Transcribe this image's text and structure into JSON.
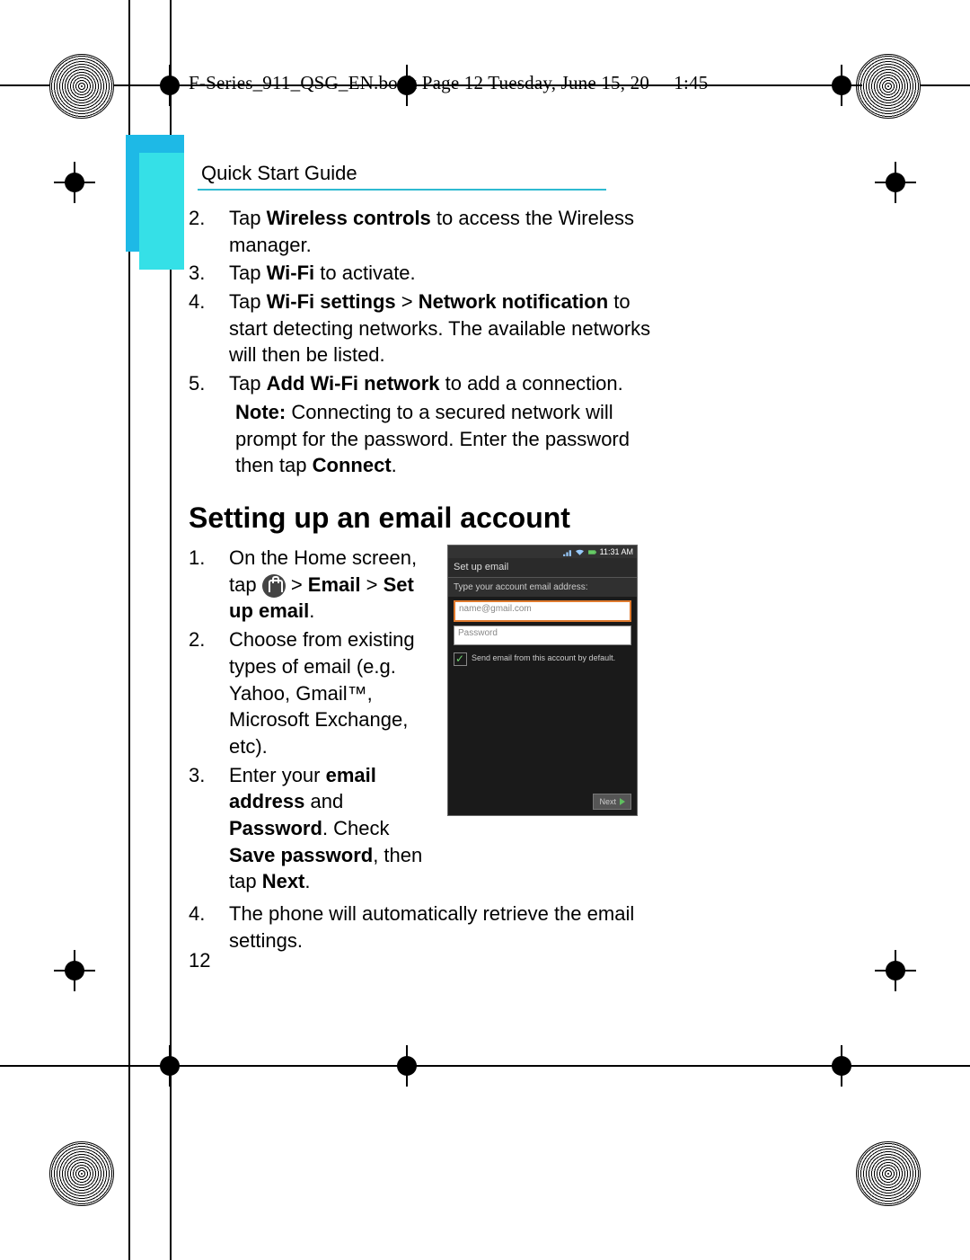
{
  "file_header": "F-Series_911_QSG_EN.book  Page 12  Tuesday, June 15, 20",
  "file_header_time_fragment": "1:45",
  "section_title": "Quick Start Guide",
  "wifi_steps": [
    {
      "n": "2.",
      "pre": "Tap ",
      "b1": "Wireless controls",
      "post": " to access the Wireless manager."
    },
    {
      "n": "3.",
      "pre": "Tap ",
      "b1": "Wi-Fi",
      "post": " to activate."
    },
    {
      "n": "4.",
      "pre": "Tap ",
      "b1": "Wi-Fi settings",
      "mid": " > ",
      "b2": "Network notification",
      "post": " to start detecting networks. The available networks will then be listed."
    },
    {
      "n": "5.",
      "pre": "Tap ",
      "b1": "Add Wi-Fi network",
      "post": " to add a connection."
    }
  ],
  "note_label": "Note:",
  "note_text": " Connecting to a secured network will prompt for the password. Enter the password then tap ",
  "note_bold_tail": "Connect",
  "note_period": ".",
  "heading_email": "Setting up an email account",
  "email_steps": {
    "s1_a": "On the Home screen, tap ",
    "s1_b": " > ",
    "s1_c": "Email",
    "s1_d": " > ",
    "s1_e": "Set up email",
    "s1_f": ".",
    "s2": "Choose from existing types of email (e.g. Yahoo, Gmail™, Microsoft Exchange, etc).",
    "s3_a": "Enter your ",
    "s3_b": "email address",
    "s3_c": " and ",
    "s3_d": "Password",
    "s3_e": ". Check ",
    "s3_f": "Save password",
    "s3_g": ", then tap ",
    "s3_h": "Next",
    "s3_i": ".",
    "s4": "The phone will automatically retrieve the email settings."
  },
  "phone": {
    "time": "11:31 AM",
    "title": "Set up email",
    "instruction": "Type your account email address:",
    "email_placeholder": "name@gmail.com",
    "password_placeholder": "Password",
    "checkbox_label": "Send email from this account by default.",
    "next_label": "Next"
  },
  "page_number": "12"
}
